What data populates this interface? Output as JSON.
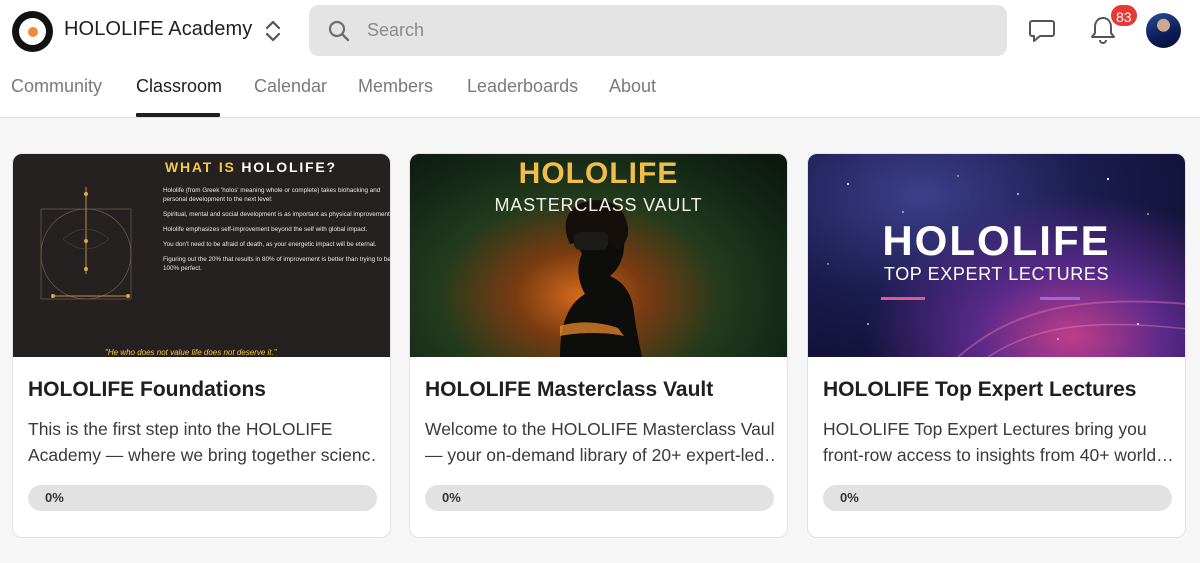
{
  "header": {
    "group_name": "HOLOLIFE Academy",
    "search": {
      "placeholder": "Search",
      "value": ""
    },
    "notifications_count": "83",
    "icons": [
      "logo",
      "switch-group-icon",
      "search-icon",
      "chat-icon",
      "bell-icon",
      "avatar"
    ]
  },
  "tabs": [
    {
      "label": "Community",
      "active": false
    },
    {
      "label": "Classroom",
      "active": true
    },
    {
      "label": "Calendar",
      "active": false
    },
    {
      "label": "Members",
      "active": false
    },
    {
      "label": "Leaderboards",
      "active": false
    },
    {
      "label": "About",
      "active": false
    }
  ],
  "courses": [
    {
      "title": "HOLOLIFE Foundations",
      "description_lines": [
        "This is the first step into the HOLOLIFE",
        "Academy — where we bring together scienc…"
      ],
      "progress_label": "0%",
      "progress": 0,
      "thumbnail": {
        "heading_prefix": "WHAT IS ",
        "heading_strong": "HOLOLIFE?",
        "paragraphs": [
          "Hololife (from Greek 'holos' meaning whole or complete) takes biohacking and personal development to the next level:",
          "Spiritual, mental and social development is as important as physical improvement.",
          "Hololife emphasizes self-improvement beyond the self with global impact.",
          "You don't need to be afraid of death, as your energetic impact will be eternal.",
          "Figuring out the 20% that results in 80% of improvement is better than trying to be 100% perfect."
        ],
        "quote": "\"He who does not value life does not deserve it.\""
      }
    },
    {
      "title": "HOLOLIFE Masterclass Vault",
      "description_lines": [
        "Welcome to the HOLOLIFE Masterclass Vault",
        "— your on-demand library of 20+ expert-led…"
      ],
      "progress_label": "0%",
      "progress": 0,
      "thumbnail": {
        "heading": "HOLOLIFE",
        "subheading": "MASTERCLASS VAULT"
      }
    },
    {
      "title": "HOLOLIFE Top Expert Lectures",
      "description_lines": [
        "HOLOLIFE Top Expert Lectures bring you",
        "front-row access to insights from 40+ world…"
      ],
      "progress_label": "0%",
      "progress": 0,
      "thumbnail": {
        "heading": "HOLOLIFE",
        "subheading": "TOP EXPERT LECTURES"
      }
    }
  ],
  "colors": {
    "accent_gold": "#f3bd4a",
    "badge_red": "#e53935",
    "logo_dot": "#f08a3a",
    "active_tab": "#1f1f1f",
    "inactive_tab": "#7a7a7a"
  }
}
